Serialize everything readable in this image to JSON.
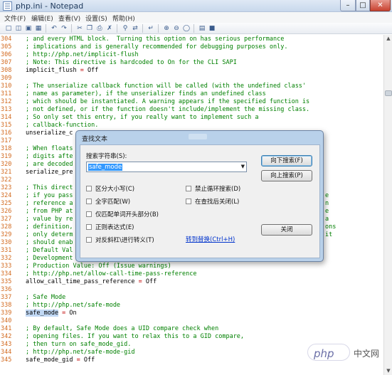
{
  "window": {
    "title": "php.ini - Notepad"
  },
  "menu": [
    "文件(F)",
    "编辑(E)",
    "查看(V)",
    "设置(S)",
    "帮助(H)"
  ],
  "editor": {
    "lines": [
      {
        "n": "304",
        "t": "; and every HTML block.  Turning this option on has serious performance",
        "k": "comment"
      },
      {
        "n": "305",
        "t": "; implications and is generally recommended for debugging purposes only.",
        "k": "comment"
      },
      {
        "n": "306",
        "t": "; http://php.net/implicit-flush",
        "k": "comment"
      },
      {
        "n": "307",
        "t": "; Note: This directive is hardcoded to On for the CLI SAPI",
        "k": "comment"
      },
      {
        "n": "308",
        "t": "implicit_flush = Off",
        "k": "kv"
      },
      {
        "n": "309",
        "t": "",
        "k": "comment"
      },
      {
        "n": "310",
        "t": "; The unserialize callback function will be called (with the undefined class'",
        "k": "comment"
      },
      {
        "n": "311",
        "t": "; name as parameter), if the unserializer finds an undefined class",
        "k": "comment"
      },
      {
        "n": "312",
        "t": "; which should be instantiated. A warning appears if the specified function is",
        "k": "comment"
      },
      {
        "n": "313",
        "t": "; not defined, or if the function doesn't include/implement the missing class.",
        "k": "comment"
      },
      {
        "n": "314",
        "t": "; So only set this entry, if you really want to implement such a",
        "k": "comment"
      },
      {
        "n": "315",
        "t": "; callback-function.",
        "k": "comment"
      },
      {
        "n": "316",
        "t": "unserialize_c",
        "k": "kv"
      },
      {
        "n": "317",
        "t": "",
        "k": "comment"
      },
      {
        "n": "318",
        "t": "; When floats",
        "k": "comment"
      },
      {
        "n": "319",
        "t": "; digits afte",
        "k": "comment"
      },
      {
        "n": "320",
        "t": "; are decoded",
        "k": "comment"
      },
      {
        "n": "321",
        "t": "serialize_pre",
        "k": "kv"
      },
      {
        "n": "322",
        "t": "",
        "k": "comment"
      },
      {
        "n": "323",
        "t": "; This direct",
        "k": "comment"
      },
      {
        "n": "324",
        "t": "; if you pass",
        "k": "comment"
      },
      {
        "n": "325",
        "t": "; reference a",
        "k": "comment"
      },
      {
        "n": "326",
        "t": "; from PHP at",
        "k": "comment"
      },
      {
        "n": "327",
        "t": "; value by re",
        "k": "comment"
      },
      {
        "n": "328",
        "t": "; definition,",
        "k": "comment"
      },
      {
        "n": "329",
        "t": "; only determ",
        "k": "comment"
      },
      {
        "n": "330",
        "t": "; should enab",
        "k": "comment"
      },
      {
        "n": "331",
        "t": "; Default Val",
        "k": "comment"
      },
      {
        "n": "332",
        "t": "; Development Value: Off (Issue warnings)",
        "k": "comment"
      },
      {
        "n": "333",
        "t": "; Production Value: Off (Issue warnings)",
        "k": "comment"
      },
      {
        "n": "334",
        "t": "; http://php.net/allow-call-time-pass-reference",
        "k": "comment"
      },
      {
        "n": "335",
        "t": "allow_call_time_pass_reference = Off",
        "k": "kv"
      },
      {
        "n": "336",
        "t": "",
        "k": "comment"
      },
      {
        "n": "337",
        "t": "; Safe Mode",
        "k": "comment"
      },
      {
        "n": "338",
        "t": "; http://php.net/safe-mode",
        "k": "comment"
      },
      {
        "n": "339",
        "t": "safe_mode = On",
        "k": "kv"
      },
      {
        "n": "340",
        "t": "",
        "k": "comment"
      },
      {
        "n": "341",
        "t": "; By default, Safe Mode does a UID compare check when",
        "k": "comment"
      },
      {
        "n": "342",
        "t": "; opening files. If you want to relax this to a GID compare,",
        "k": "comment"
      },
      {
        "n": "343",
        "t": "; then turn on safe_mode_gid.",
        "k": "comment"
      },
      {
        "n": "344",
        "t": "; http://php.net/safe-mode-gid",
        "k": "comment"
      },
      {
        "n": "345",
        "t": "safe_mode_gid = Off",
        "k": "kv"
      }
    ],
    "right_fragments": [
      {
        "row": 20,
        "t": "e"
      },
      {
        "row": 21,
        "t": "n"
      },
      {
        "row": 22,
        "t": "e"
      },
      {
        "row": 23,
        "t": "a"
      },
      {
        "row": 24,
        "t": "ons"
      },
      {
        "row": 25,
        "t": "it"
      }
    ]
  },
  "dialog": {
    "title": "查找文本",
    "search_label": "搜索字符串(S):",
    "search_value": "safe_mode",
    "btn_find_down": "向下搜索(F)",
    "btn_find_up": "向上搜索(P)",
    "btn_close": "关闭",
    "options": [
      {
        "label": "区分大小写(C)",
        "checked": false
      },
      {
        "label": "全字匹配(W)",
        "checked": false
      },
      {
        "label": "仅匹配单词开头部分(B)",
        "checked": false
      },
      {
        "label": "正则表达式(E)",
        "checked": false
      },
      {
        "label": "对反斜杠\\进行转义(T)",
        "checked": false
      }
    ],
    "options_right": [
      {
        "label": "禁止循环搜索(D)",
        "checked": false
      },
      {
        "label": "在查找后关闭(L)",
        "checked": false
      }
    ],
    "goto_replace_link": "转到替换(Ctrl+H)"
  },
  "watermark": {
    "logo_text": "php",
    "site_text": "中文网"
  },
  "colors": {
    "comment": "#008000",
    "line_number": "#d2691e",
    "operator": "#c00000",
    "dialog_frame": "#b9d1ea"
  }
}
